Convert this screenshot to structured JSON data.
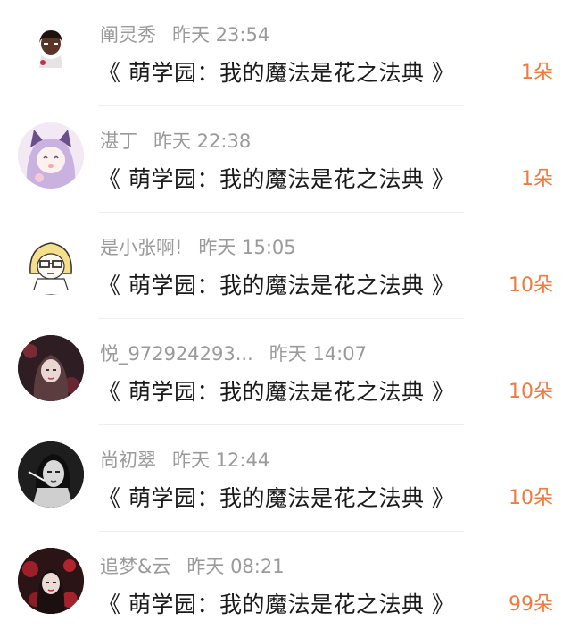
{
  "items": [
    {
      "name": "阐灵秀",
      "time": "昨天 23:54",
      "book": "《 萌学园：我的魔法是花之法典 》",
      "amount": "1朵",
      "avatar": "avatar-dark-skin-character"
    },
    {
      "name": "湛丁",
      "time": "昨天 22:38",
      "book": "《 萌学园：我的魔法是花之法典 》",
      "amount": "1朵",
      "avatar": "avatar-anime-cat-girl"
    },
    {
      "name": "是小张啊!",
      "time": "昨天 15:05",
      "book": "《 萌学园：我的魔法是花之法典 》",
      "amount": "10朵",
      "avatar": "avatar-glasses-cartoon"
    },
    {
      "name": "悦_972924293...",
      "time": "昨天 14:07",
      "book": "《 萌学园：我的魔法是花之法典 》",
      "amount": "10朵",
      "avatar": "avatar-dark-portrait"
    },
    {
      "name": "尚初翠",
      "time": "昨天 12:44",
      "book": "《 萌学园：我的魔法是花之法典 》",
      "amount": "10朵",
      "avatar": "avatar-monochrome-woman"
    },
    {
      "name": "追梦&云",
      "time": "昨天 08:21",
      "book": "《 萌学园：我的魔法是花之法典 》",
      "amount": "99朵",
      "avatar": "avatar-red-floral-portrait"
    }
  ],
  "colors": {
    "amount": "#ec7b3f",
    "meta": "#9a9a9a",
    "title": "#1a1a1a"
  }
}
